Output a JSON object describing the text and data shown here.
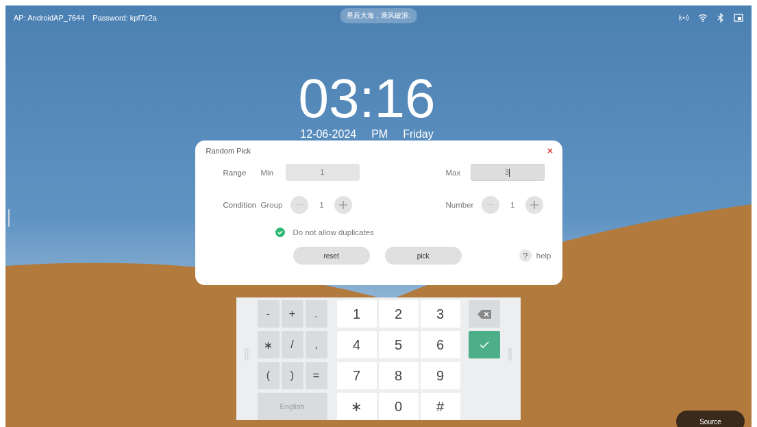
{
  "status_bar": {
    "ap": "AP: AndroidAP_7644",
    "password": "Password: kpf7ir2a",
    "banner": "星辰大海，乘风破浪:"
  },
  "clock": {
    "time": "03:16",
    "date": "12-06-2024",
    "period": "PM",
    "weekday": "Friday"
  },
  "dialog": {
    "title": "Random Pick",
    "range": {
      "label": "Range",
      "fields": [
        {
          "label": "Min",
          "value": "1",
          "focused": false
        },
        {
          "label": "Max",
          "value": "3",
          "focused": true
        }
      ]
    },
    "condition": {
      "label": "Condition",
      "steppers": [
        {
          "label": "Group",
          "value": "1",
          "minus_disabled": true
        },
        {
          "label": "Number",
          "value": "1",
          "minus_disabled": true
        }
      ]
    },
    "checkbox": {
      "label": "Do not allow duplicates",
      "checked": true
    },
    "buttons": [
      "reset",
      "pick"
    ],
    "help": "help"
  },
  "keyboard": {
    "rows": [
      {
        "symbols": [
          {
            "label": "-"
          },
          {
            "label": "+"
          },
          {
            "label": "."
          }
        ],
        "digits": [
          "1",
          "2",
          "3"
        ],
        "action": {
          "kind": "backspace"
        }
      },
      {
        "symbols": [
          {
            "label": "∗"
          },
          {
            "label": "/"
          },
          {
            "label": ","
          }
        ],
        "digits": [
          "4",
          "5",
          "6"
        ],
        "action": {
          "kind": "enter"
        }
      },
      {
        "symbols": [
          {
            "label": "("
          },
          {
            "label": ")"
          },
          {
            "label": "="
          }
        ],
        "digits": [
          "7",
          "8",
          "9"
        ],
        "action": {
          "kind": "none"
        }
      },
      {
        "symbols": [
          {
            "label": "English"
          }
        ],
        "digits": [
          "∗",
          "0",
          "#"
        ],
        "action": {
          "kind": "none"
        }
      }
    ]
  },
  "source_button": "Source"
}
